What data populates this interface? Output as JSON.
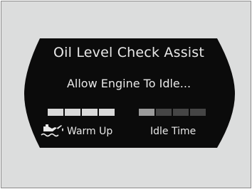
{
  "display": {
    "title": "Oil Level Check Assist",
    "message": "Allow Engine To Idle...",
    "warm_up": {
      "label": "Warm Up",
      "icon": "oil-can-icon",
      "segments_total": 4,
      "segments_filled": 4
    },
    "idle_time": {
      "label": "Idle Time",
      "segments_total": 4,
      "segments_filled": 1
    }
  },
  "colors": {
    "screen_background": "#0b0b0b",
    "panel_background": "#dcdddd",
    "text": "#e8e8e8",
    "segment_on": "#d9d9d9",
    "segment_off": "#454545"
  }
}
